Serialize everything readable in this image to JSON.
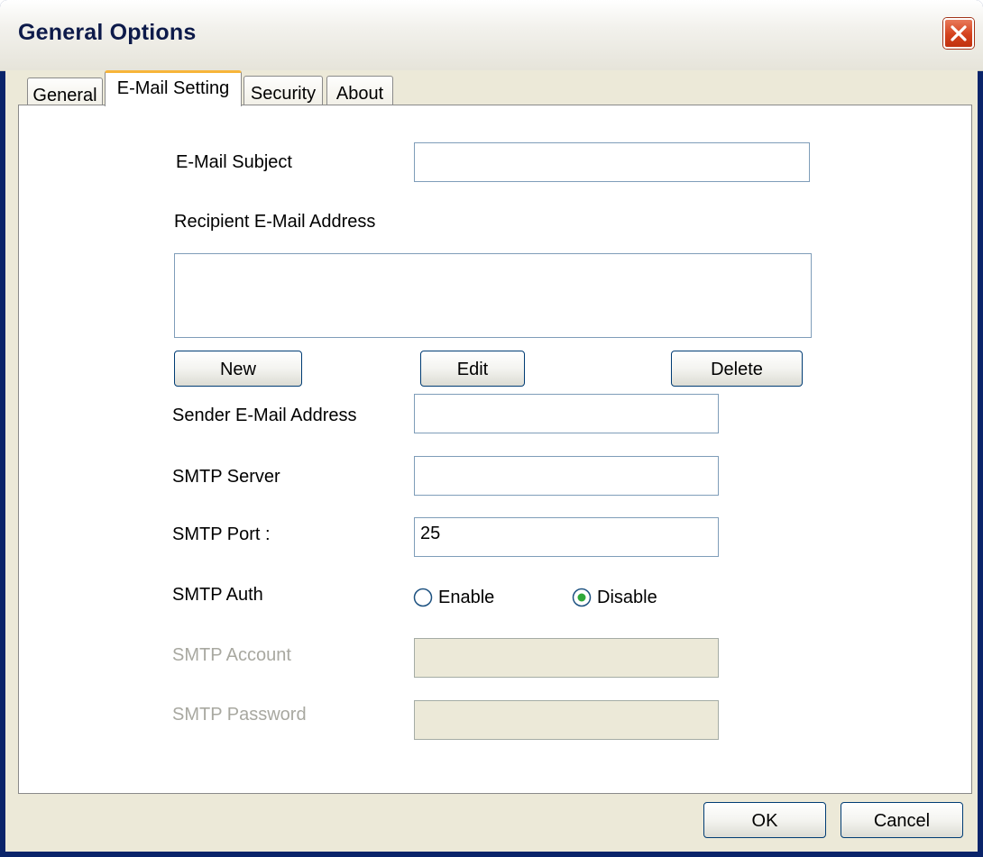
{
  "window": {
    "title": "General Options"
  },
  "tabs": [
    {
      "label": "General",
      "active": false
    },
    {
      "label": "E-Mail Setting",
      "active": true
    },
    {
      "label": "Security",
      "active": false
    },
    {
      "label": "About",
      "active": false
    }
  ],
  "email": {
    "subject_label": "E-Mail Subject",
    "subject_value": "",
    "recipient_label": "Recipient E-Mail Address",
    "recipients": [],
    "new_label": "New",
    "edit_label": "Edit",
    "delete_label": "Delete",
    "sender_label": "Sender E-Mail Address",
    "sender_value": "",
    "smtp_server_label": "SMTP Server",
    "smtp_server_value": "",
    "smtp_port_label": "SMTP Port :",
    "smtp_port_value": "25",
    "smtp_auth_label": "SMTP Auth",
    "auth_enable_label": "Enable",
    "auth_disable_label": "Disable",
    "auth_selected": "Disable",
    "smtp_account_label": "SMTP Account",
    "smtp_account_value": "",
    "smtp_password_label": "SMTP Password",
    "smtp_password_value": ""
  },
  "footer": {
    "ok_label": "OK",
    "cancel_label": "Cancel"
  },
  "icons": {
    "close": "close-icon",
    "radio_off": "radio-unchecked-icon",
    "radio_on": "radio-checked-icon"
  },
  "colors": {
    "accent_tab": "#f7b53a",
    "close_button": "#d4421e",
    "dialog_bg": "#ece9d8"
  }
}
